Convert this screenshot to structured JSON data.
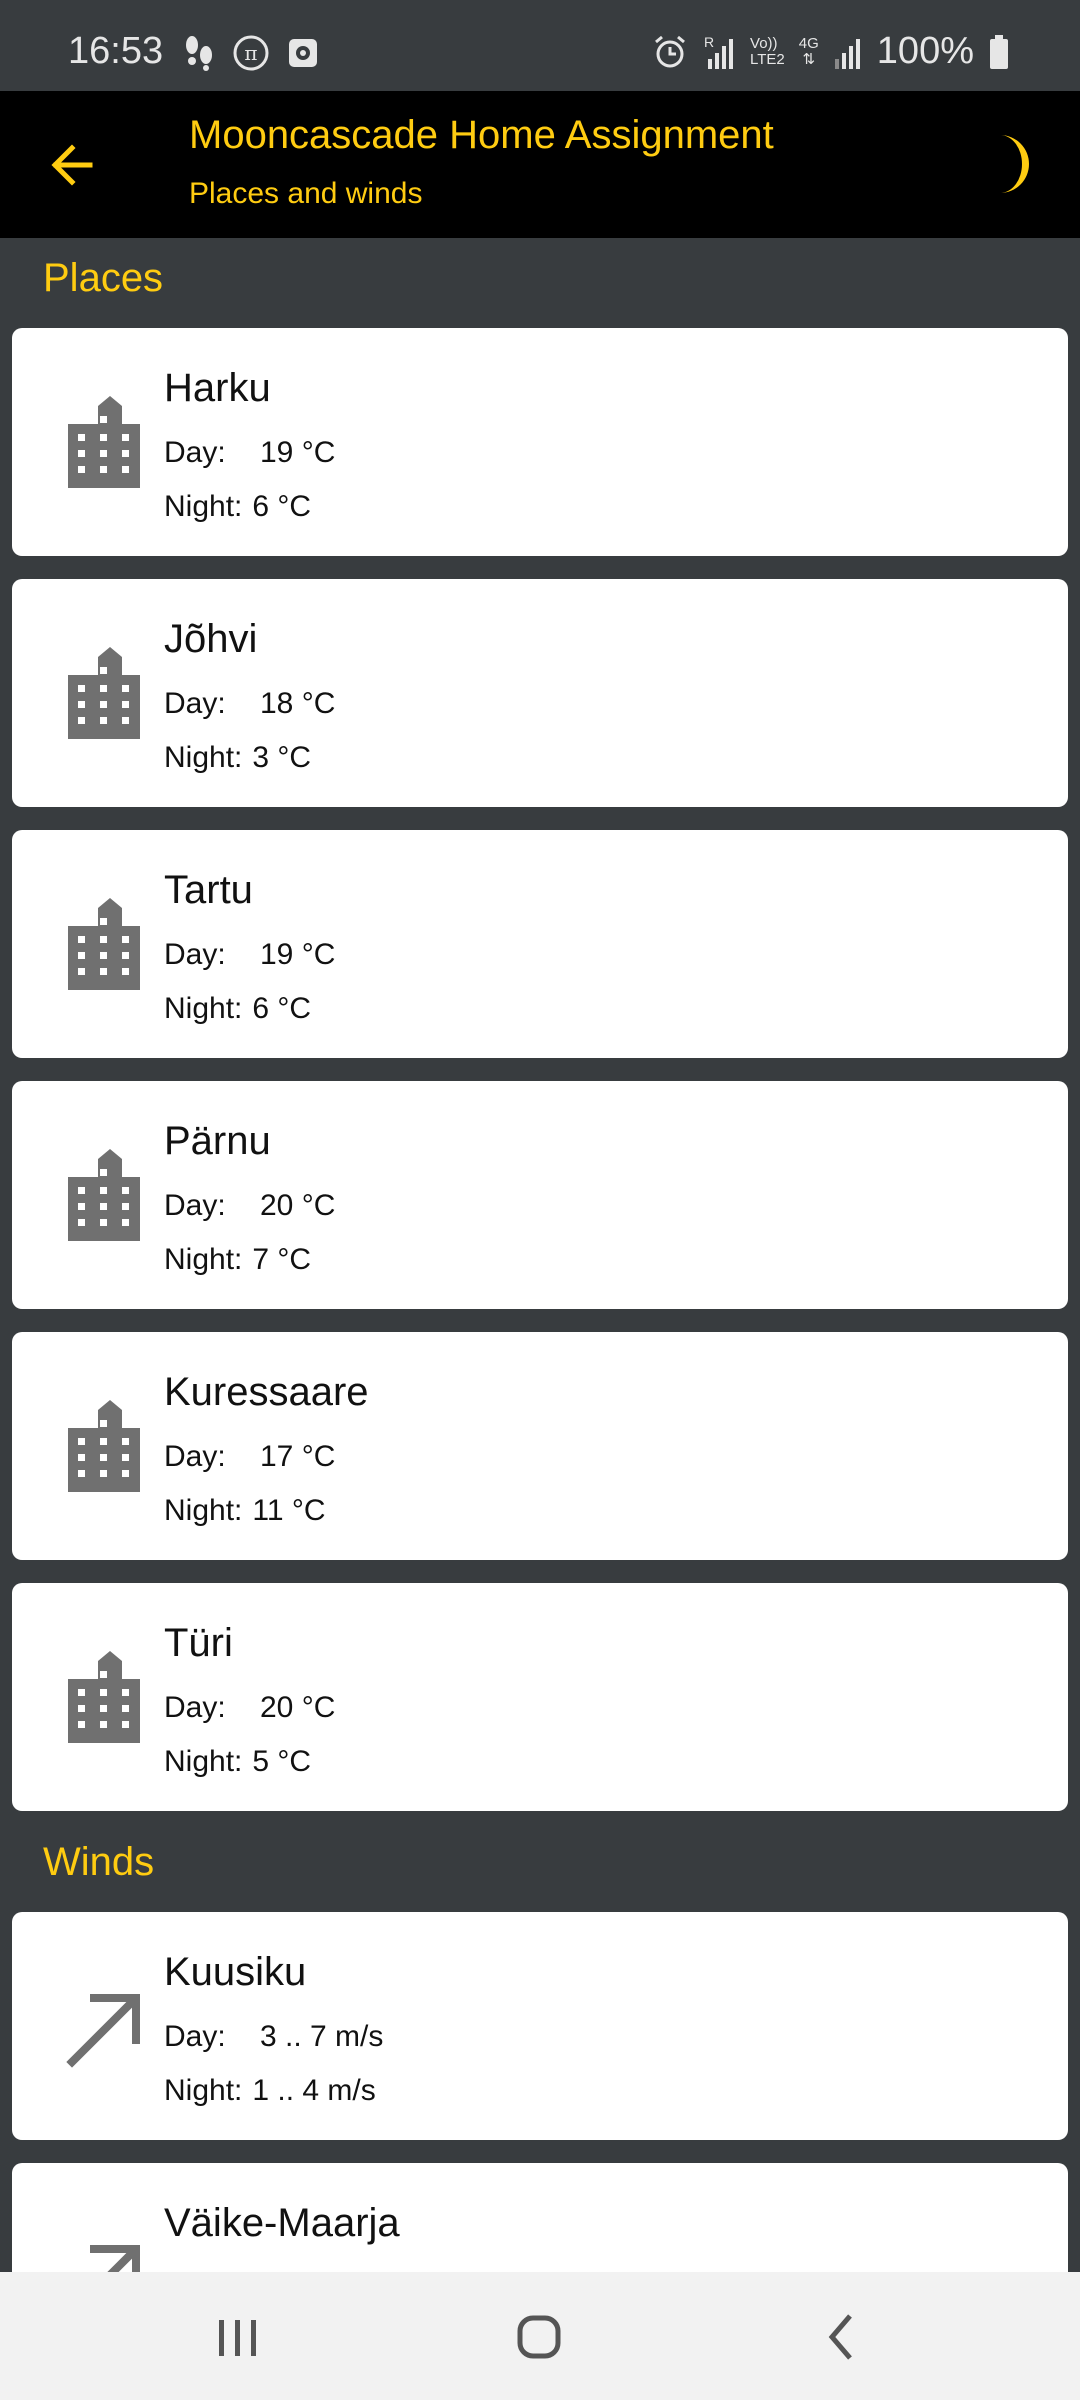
{
  "status": {
    "time": "16:53",
    "battery": "100%",
    "network_label_a": "Vo))",
    "network_label_b": "LTE2",
    "network_label_c": "4G",
    "roaming": "R"
  },
  "app_bar": {
    "title": "Mooncascade Home Assignment",
    "subtitle": "Places and winds"
  },
  "sections": {
    "places_header": "Places",
    "winds_header": "Winds"
  },
  "places": [
    {
      "name": "Harku",
      "day_label": "Day:",
      "day": "19 °C",
      "night_label": "Night:",
      "night": "6 °C",
      "icon": "city-icon"
    },
    {
      "name": "Jõhvi",
      "day_label": "Day:",
      "day": "18 °C",
      "night_label": "Night:",
      "night": "3 °C",
      "icon": "city-icon"
    },
    {
      "name": "Tartu",
      "day_label": "Day:",
      "day": "19 °C",
      "night_label": "Night:",
      "night": "6 °C",
      "icon": "city-icon"
    },
    {
      "name": "Pärnu",
      "day_label": "Day:",
      "day": "20 °C",
      "night_label": "Night:",
      "night": "7 °C",
      "icon": "city-icon"
    },
    {
      "name": "Kuressaare",
      "day_label": "Day:",
      "day": "17 °C",
      "night_label": "Night:",
      "night": "11 °C",
      "icon": "city-icon"
    },
    {
      "name": "Türi",
      "day_label": "Day:",
      "day": "20 °C",
      "night_label": "Night:",
      "night": "5 °C",
      "icon": "city-icon"
    }
  ],
  "winds": [
    {
      "name": "Kuusiku",
      "day_label": "Day:",
      "day": "3 .. 7 m/s",
      "night_label": "Night:",
      "night": "1 .. 4 m/s",
      "icon": "wind-direction-arrow-icon"
    },
    {
      "name": "Väike-Maarja",
      "icon": "wind-direction-arrow-icon"
    }
  ],
  "colors": {
    "accent": "#ffcc11",
    "background": "#383c3f",
    "app_bar": "#000000",
    "card": "#ffffff",
    "icon_gray": "#707070"
  }
}
